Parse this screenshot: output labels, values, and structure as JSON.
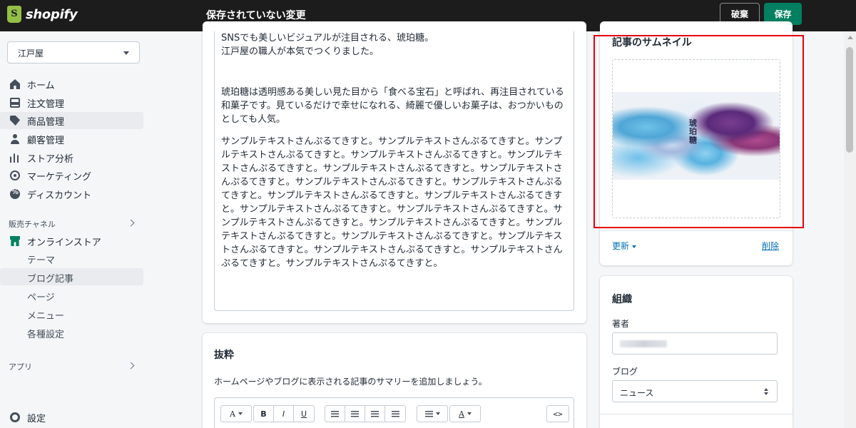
{
  "header": {
    "brand": "shopify",
    "title": "保存されていない変更",
    "discard_label": "破棄",
    "save_label": "保存"
  },
  "sidebar": {
    "store_name": "江戸屋",
    "items": [
      {
        "label": "ホーム",
        "icon": "home-icon"
      },
      {
        "label": "注文管理",
        "icon": "inbox-icon"
      },
      {
        "label": "商品管理",
        "icon": "tag-icon"
      },
      {
        "label": "顧客管理",
        "icon": "person-icon"
      },
      {
        "label": "ストア分析",
        "icon": "bar-chart-icon"
      },
      {
        "label": "マーケティング",
        "icon": "target-icon"
      },
      {
        "label": "ディスカウント",
        "icon": "discount-icon"
      }
    ],
    "sales_channels_label": "販売チャネル",
    "online_store": {
      "label": "オンラインストア",
      "sub": [
        "テーマ",
        "ブログ記事",
        "ページ",
        "メニュー",
        "各種設定"
      ]
    },
    "apps_label": "アプリ",
    "settings_label": "設定"
  },
  "editor": {
    "paragraphs": [
      "SNSでも美しいビジュアルが注目される、琥珀糖。",
      "江戸屋の職人が本気でつくりました。",
      "琥珀糖は透明感ある美しい見た目から「食べる宝石」と呼ばれ、再注目されている和菓子です。見ているだけで幸せになれる、綺麗で優しいお菓子は、おつかいものとしても人気。",
      "サンプルテキストさんぷるてきすと。サンプルテキストさんぷるてきすと。サンプルテキストさんぷるてきすと。サンプルテキストさんぷるてきすと。サンプルテキストさんぷるてきすと。サンプルテキストさんぷるてきすと。サンプルテキストさんぷるてきすと。サンプルテキストさんぷるてきすと。サンプルテキストさんぷるてきすと。サンプルテキストさんぷるてきすと。サンプルテキストさんぷるてきすと。サンプルテキストさんぷるてきすと。サンプルテキストさんぷるてきすと。サンプルテキストさんぷるてきすと。サンプルテキストさんぷるてきすと。サンプルテキストさんぷるてきすと。サンプルテキストさんぷるてきすと。サンプルテキストさんぷるてきすと。サンプルテキストさんぷるてきすと。サンプルテキストさんぷるてきすと。サンプルテキストさんぷるてきすと。"
    ]
  },
  "excerpt": {
    "title": "抜粋",
    "help": "ホームページやブログに表示される記事のサマリーを追加しましょう。",
    "toolbar": {
      "font": "A",
      "bold": "B",
      "italic": "I",
      "underline": "U",
      "text_color": "A",
      "code": "<>"
    }
  },
  "thumbnail": {
    "title": "記事のサムネイル",
    "image_text": "琥珀糖",
    "update_label": "更新",
    "delete_label": "削除"
  },
  "organization": {
    "title": "組織",
    "author_label": "著者",
    "blog_label": "ブログ",
    "blog_value": "ニュース"
  }
}
